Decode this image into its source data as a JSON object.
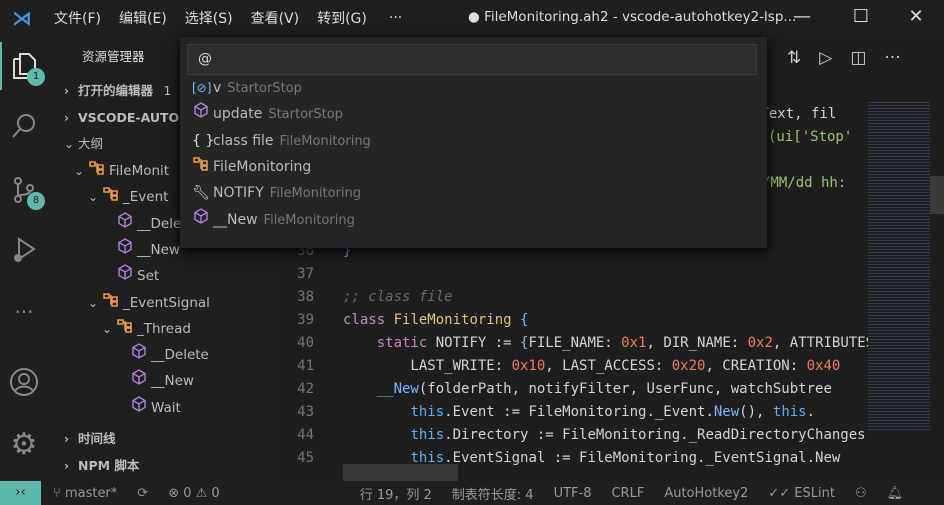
{
  "titlebar": {
    "menus": [
      "文件(F)",
      "编辑(E)",
      "选择(S)",
      "查看(V)",
      "转到(G)",
      "···"
    ],
    "title": "● FileMonitoring.ah2 - vscode-autohotkey2-lsp...",
    "minimize": "—",
    "maximize": "☐",
    "close": "✕"
  },
  "activity": {
    "explorer_badge": "1",
    "scm_badge": "8"
  },
  "sidebar": {
    "title": "资源管理器",
    "open_editors": "打开的编辑器",
    "open_editors_count": "1",
    "workspace": "VSCODE-AUTOH",
    "outline": "大纲",
    "outline_items": [
      {
        "label": "FileMonit",
        "kind": "class"
      },
      {
        "label": "_Event",
        "kind": "class"
      },
      {
        "label": "__Dele",
        "kind": "method"
      },
      {
        "label": "__New",
        "kind": "method"
      },
      {
        "label": "Set",
        "kind": "method"
      },
      {
        "label": "_EventSignal",
        "kind": "class"
      },
      {
        "label": "_Thread",
        "kind": "class"
      },
      {
        "label": "__Delete",
        "kind": "method"
      },
      {
        "label": "__New",
        "kind": "method"
      },
      {
        "label": "Wait",
        "kind": "method"
      }
    ],
    "timeline": "时间线",
    "npm": "NPM 脚本"
  },
  "quickpick": {
    "value": "@",
    "items": [
      {
        "label": "v",
        "detail": "StartorStop",
        "icon": "variable-icon"
      },
      {
        "label": "update",
        "detail": "StartorStop",
        "icon": "method-icon"
      },
      {
        "label": "class file",
        "detail": "FileMonitoring",
        "icon": "namespace-icon"
      },
      {
        "label": "FileMonitoring",
        "detail": "",
        "icon": "class-icon"
      },
      {
        "label": "NOTIFY",
        "detail": "FileMonitoring",
        "icon": "property-icon"
      },
      {
        "label": "__New",
        "detail": "FileMonitoring",
        "icon": "method-icon"
      }
    ]
  },
  "editor": {
    "partial_lines": [
      ".Text, fil",
      "(ui['Stop'",
      "/MM/dd hh:"
    ],
    "line_numbers": [
      "36",
      "37",
      "38",
      "39",
      "40",
      "41",
      "42",
      "43",
      "44",
      "45"
    ]
  },
  "status": {
    "branch": "master*",
    "errors": "0",
    "warnings": "0",
    "position": "行 19，列 2",
    "tab": "制表符长度: 4",
    "encoding": "UTF-8",
    "eol": "CRLF",
    "language": "AutoHotkey2",
    "eslint": "ESLint"
  },
  "colors": {
    "accent": "#5fb8ac",
    "class_icon": "#ee9d28",
    "method_icon": "#b180d7"
  }
}
